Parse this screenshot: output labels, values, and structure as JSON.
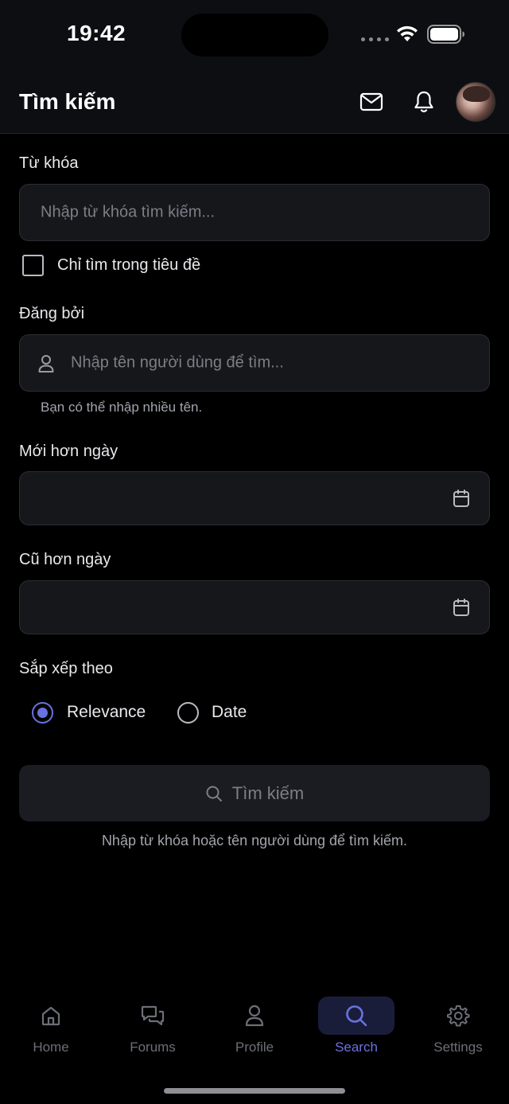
{
  "status_bar": {
    "time": "19:42"
  },
  "header": {
    "title": "Tìm kiếm"
  },
  "form": {
    "keyword_label": "Từ khóa",
    "keyword_placeholder": "Nhập từ khóa tìm kiếm...",
    "title_only_label": "Chỉ tìm trong tiêu đề",
    "title_only_checked": false,
    "posted_by_label": "Đăng bởi",
    "posted_by_placeholder": "Nhập tên người dùng để tìm...",
    "posted_by_hint": "Bạn có thể nhập nhiều tên.",
    "newer_than_label": "Mới hơn ngày",
    "newer_than_value": "",
    "older_than_label": "Cũ hơn ngày",
    "older_than_value": "",
    "sort_label": "Sắp xếp theo",
    "sort_options": [
      {
        "label": "Relevance",
        "selected": true
      },
      {
        "label": "Date",
        "selected": false
      }
    ],
    "search_button_label": "Tìm kiếm",
    "footer_hint": "Nhập từ khóa hoặc tên người dùng để tìm kiếm."
  },
  "tabs": [
    {
      "label": "Home",
      "icon": "home-icon",
      "active": false
    },
    {
      "label": "Forums",
      "icon": "chat-bubbles-icon",
      "active": false
    },
    {
      "label": "Profile",
      "icon": "user-icon",
      "active": false
    },
    {
      "label": "Search",
      "icon": "search-icon",
      "active": true
    },
    {
      "label": "Settings",
      "icon": "gear-icon",
      "active": false
    }
  ],
  "colors": {
    "accent": "#6a72e0",
    "background": "#000000",
    "surface": "#16171b"
  }
}
